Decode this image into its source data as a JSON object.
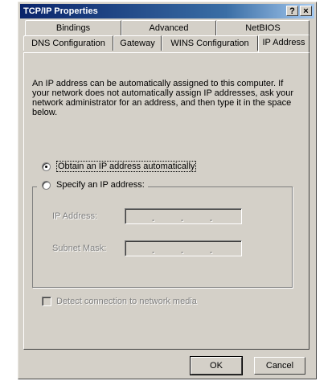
{
  "window": {
    "title": "TCP/IP Properties",
    "help_glyph": "?",
    "close_glyph": "×"
  },
  "tabs": {
    "row1": [
      "Bindings",
      "Advanced",
      "NetBIOS"
    ],
    "row2": [
      "DNS Configuration",
      "Gateway",
      "WINS Configuration",
      "IP Address"
    ],
    "active": "IP Address"
  },
  "panel": {
    "description": "An IP address can be automatically assigned to this computer. If your network does not automatically assign IP addresses, ask your network administrator for an address, and then type it in the space below.",
    "obtain_auto": {
      "label": "Obtain an IP address automatically",
      "checked": true
    },
    "specify": {
      "label": "Specify an IP address:",
      "checked": false
    },
    "ip_address_label": "IP Address:",
    "subnet_mask_label": "Subnet Mask:",
    "ip_dots": ".",
    "detect_media": {
      "label": "Detect connection to network media",
      "checked": false,
      "disabled": true
    }
  },
  "buttons": {
    "ok": "OK",
    "cancel": "Cancel"
  },
  "colors": {
    "dialog_face": "#d4d0c8",
    "title_bar_start": "#0a246a",
    "title_bar_end": "#a6caf0",
    "disabled_text": "#808080"
  }
}
